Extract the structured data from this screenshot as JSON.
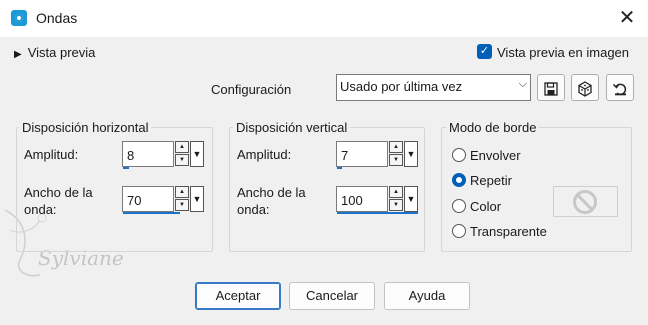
{
  "window": {
    "title": "Ondas",
    "close_glyph": "✕"
  },
  "preview": {
    "toggle_label": "Vista previa",
    "checkbox_label": "Vista previa en imagen",
    "checked": true
  },
  "config": {
    "label": "Configuración",
    "selected": "Usado por última vez",
    "icons": [
      "save-icon",
      "cube-icon",
      "reset-icon"
    ]
  },
  "horizontal": {
    "title": "Disposición horizontal",
    "amplitude_label": "Amplitud:",
    "amplitude_value": "8",
    "wavelength_label_1": "Ancho de la",
    "wavelength_label_2": "onda:",
    "wavelength_value": "70"
  },
  "vertical": {
    "title": "Disposición vertical",
    "amplitude_label": "Amplitud:",
    "amplitude_value": "7",
    "wavelength_label_1": "Ancho de la",
    "wavelength_label_2": "onda:",
    "wavelength_value": "100"
  },
  "edge_mode": {
    "title": "Modo de borde",
    "options": [
      "Envolver",
      "Repetir",
      "Color",
      "Transparente"
    ],
    "selected": "Repetir"
  },
  "buttons": {
    "ok": "Aceptar",
    "cancel": "Cancelar",
    "help": "Ayuda"
  },
  "watermark": "Sylviane",
  "colors": {
    "accent": "#005fb8",
    "background": "#f0f0f0"
  }
}
